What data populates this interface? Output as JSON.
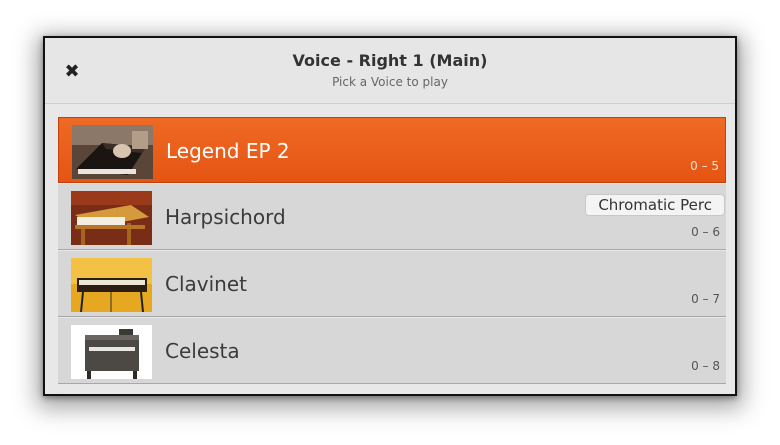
{
  "dialog": {
    "title": "Voice - Right 1 (Main)",
    "subtitle": "Pick a Voice to play",
    "close_icon": "close-icon"
  },
  "category_tag": "Chromatic Perc",
  "voices": [
    {
      "label": "Legend EP 2",
      "number": "0 – 5",
      "selected": true,
      "thumb": "electric-piano-image"
    },
    {
      "label": "Harpsichord",
      "number": "0 – 6",
      "selected": false,
      "thumb": "harpsichord-image"
    },
    {
      "label": "Clavinet",
      "number": "0 – 7",
      "selected": false,
      "thumb": "clavinet-image"
    },
    {
      "label": "Celesta",
      "number": "0 – 8",
      "selected": false,
      "thumb": "celesta-image"
    }
  ],
  "colors": {
    "selected_bg": "#e85d18",
    "row_bg": "#d7d7d7",
    "header_bg": "#e6e6e6"
  }
}
